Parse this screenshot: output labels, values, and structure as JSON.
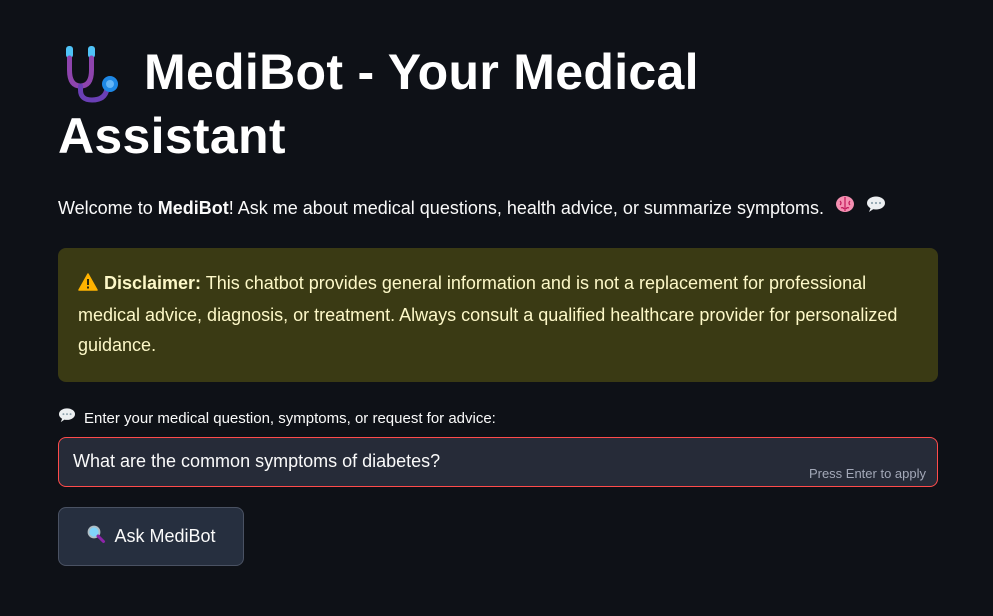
{
  "header": {
    "title_line1": "MediBot - Your Medical",
    "title_line2": "Assistant",
    "title_icon": "stethoscope-icon"
  },
  "welcome": {
    "prefix": "Welcome to ",
    "bot_name": "MediBot",
    "suffix": "! Ask me about medical questions, health advice, or summarize symptoms.",
    "emoji_1": "brain-icon",
    "emoji_2": "speech-bubble-icon"
  },
  "disclaimer": {
    "icon": "warning-icon",
    "label": "Disclaimer:",
    "text": " This chatbot provides general information and is not a replacement for professional medical advice, diagnosis, or treatment. Always consult a qualified healthcare provider for personalized guidance.",
    "bg_color": "#3a3a14",
    "text_color": "#fdf8c8"
  },
  "input": {
    "label": "Enter your medical question, symptoms, or request for advice:",
    "value": "What are the common symptoms of diabetes?",
    "hint": "Press Enter to apply",
    "border_color": "#ff4b4b"
  },
  "button": {
    "label": "Ask MediBot",
    "icon": "magnifier-icon"
  },
  "colors": {
    "background": "#0e1117",
    "text": "#fafafa"
  }
}
